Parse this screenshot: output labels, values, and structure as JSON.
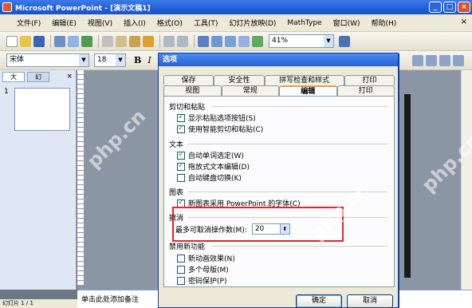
{
  "window": {
    "title": "Microsoft PowerPoint - [演示文稿1]",
    "minimize": "_",
    "maximize": "□",
    "close": "×"
  },
  "menubar": {
    "items": [
      "文件(F)",
      "编辑(E)",
      "视图(V)",
      "插入(I)",
      "格式(O)",
      "工具(T)",
      "幻灯片放映(D)",
      "MathType",
      "窗口(W)",
      "帮助(H)"
    ],
    "close_doc": "×"
  },
  "toolbar": {
    "zoom": "41%",
    "font_name": "宋体",
    "font_size": "18",
    "bold": "B",
    "italic": "I"
  },
  "left_pane": {
    "tab_outline": "大",
    "tab_slides": "幻",
    "close": "×",
    "slide_number": "1"
  },
  "notes": {
    "placeholder": "单击此处添加备注"
  },
  "status": {
    "text": "幻灯片 1 / 1"
  },
  "dialog": {
    "title": "选项",
    "tabs_back": [
      "保存",
      "安全性",
      "拼写检查和样式",
      "打印"
    ],
    "tabs_front": [
      "视图",
      "常规",
      "编辑",
      "打印"
    ],
    "active_tab": "编辑",
    "groups": {
      "cut_paste": "剪切和粘贴",
      "text": "文本",
      "chart": "图表",
      "undo": "撤消",
      "disabled": "禁用新功能"
    },
    "options": {
      "show_paste_options": {
        "label": "显示粘贴选项按钮(S)",
        "checked": true
      },
      "smart_cut_paste": {
        "label": "使用智能剪切和粘贴(C)",
        "checked": true
      },
      "auto_select_word": {
        "label": "自动单词选定(W)",
        "checked": true
      },
      "drag_drop_text": {
        "label": "拖放式文本编辑(D)",
        "checked": true
      },
      "auto_keyboard_switch": {
        "label": "自动键盘切换(K)",
        "checked": false
      },
      "new_chart_font": {
        "label": "新图表采用 PowerPoint 的字体(C)",
        "checked": true
      },
      "new_animation_effects": {
        "label": "新动画效果(N)",
        "checked": false
      },
      "multiple_masters": {
        "label": "多个母版(M)",
        "checked": false
      },
      "password_protect": {
        "label": "密码保护(P)",
        "checked": false
      }
    },
    "undo": {
      "label": "最多可取消操作数(M):",
      "value": "20"
    },
    "ok": "确定",
    "cancel": "取消"
  },
  "watermark": "php.cn",
  "colors": {
    "title_bar": "#2563d4",
    "highlight": "#e0262a",
    "check": "#21a121"
  }
}
